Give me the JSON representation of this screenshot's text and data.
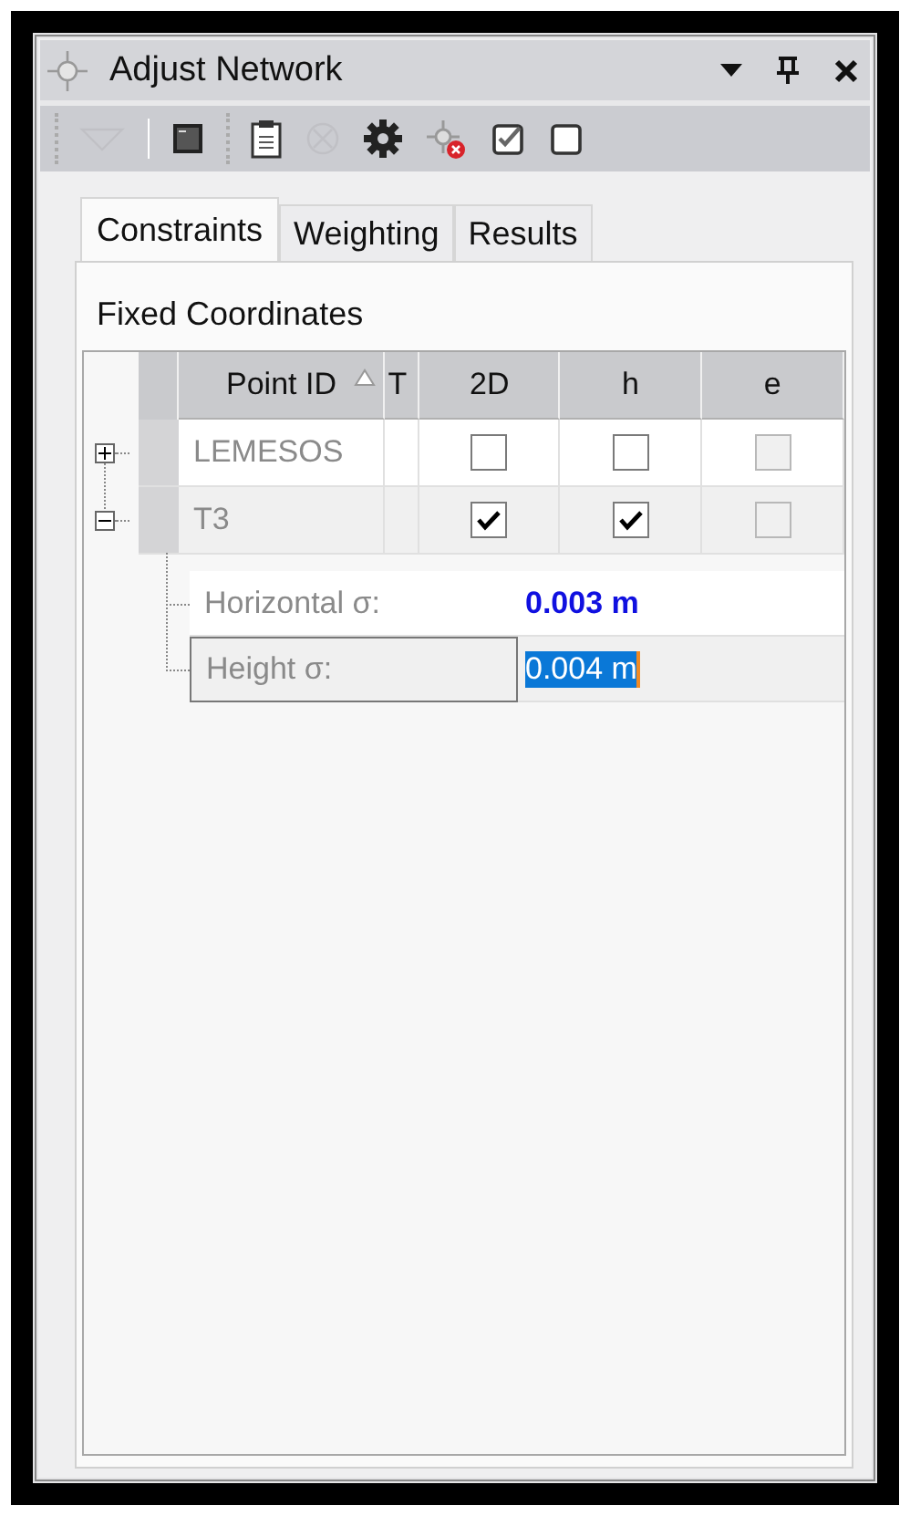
{
  "window": {
    "title": "Adjust Network"
  },
  "toolbar": [
    {
      "kind": "dropdown",
      "disabled": true
    },
    {
      "kind": "console",
      "disabled": false
    },
    {
      "kind": "clipboard",
      "disabled": false
    },
    {
      "kind": "cancel",
      "disabled": true
    },
    {
      "kind": "gear",
      "disabled": false
    },
    {
      "kind": "remove-point",
      "disabled": false
    },
    {
      "kind": "check-all",
      "disabled": false
    },
    {
      "kind": "uncheck-all",
      "disabled": false
    }
  ],
  "tabs": [
    {
      "label": "Constraints",
      "selected": true
    },
    {
      "label": "Weighting",
      "selected": false
    },
    {
      "label": "Results",
      "selected": false
    }
  ],
  "section_title": "Fixed Coordinates",
  "grid": {
    "columns": [
      {
        "label": "Point ID",
        "sorted": true
      },
      {
        "label": "T",
        "sorted": false
      },
      {
        "label": "2D",
        "sorted": false
      },
      {
        "label": "h",
        "sorted": false
      },
      {
        "label": "e",
        "sorted": false
      }
    ],
    "rows": [
      {
        "point_id": "LEMESOS",
        "expanded": false,
        "selected": false,
        "checks": [
          {
            "checked": false,
            "disabled": false
          },
          {
            "checked": false,
            "disabled": false
          },
          {
            "checked": false,
            "disabled": true
          }
        ]
      },
      {
        "point_id": "T3",
        "expanded": true,
        "selected": true,
        "checks": [
          {
            "checked": true,
            "disabled": false
          },
          {
            "checked": true,
            "disabled": false
          },
          {
            "checked": false,
            "disabled": true
          }
        ],
        "details": [
          {
            "label": "Horizontal σ:",
            "value": "0.003 m",
            "modified": true,
            "selected": false
          },
          {
            "label": "Height σ:",
            "value": "0.004 m",
            "modified": false,
            "selected": true
          }
        ]
      }
    ]
  }
}
